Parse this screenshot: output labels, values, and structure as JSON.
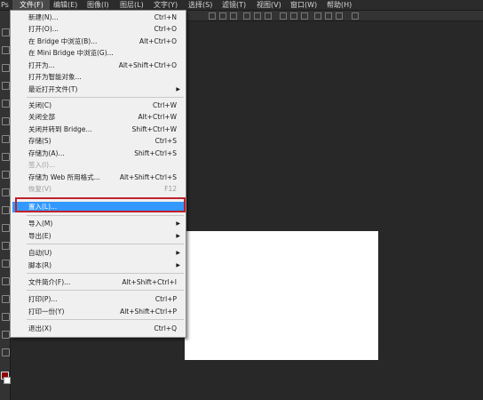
{
  "app": {
    "logo": "Ps"
  },
  "menubar": {
    "items": [
      {
        "label": "文件(F)"
      },
      {
        "label": "编辑(E)"
      },
      {
        "label": "图像(I)"
      },
      {
        "label": "图层(L)"
      },
      {
        "label": "文字(Y)"
      },
      {
        "label": "选择(S)"
      },
      {
        "label": "滤镜(T)"
      },
      {
        "label": "视图(V)"
      },
      {
        "label": "窗口(W)"
      },
      {
        "label": "帮助(H)"
      }
    ]
  },
  "file_menu": {
    "items": [
      {
        "label": "新建(N)...",
        "shortcut": "Ctrl+N"
      },
      {
        "label": "打开(O)...",
        "shortcut": "Ctrl+O"
      },
      {
        "label": "在 Bridge 中浏览(B)...",
        "shortcut": "Alt+Ctrl+O"
      },
      {
        "label": "在 Mini Bridge 中浏览(G)...",
        "shortcut": ""
      },
      {
        "label": "打开为...",
        "shortcut": "Alt+Shift+Ctrl+O"
      },
      {
        "label": "打开为智能对象...",
        "shortcut": ""
      },
      {
        "label": "最近打开文件(T)",
        "shortcut": "",
        "submenu": "▶"
      },
      {
        "label": "关闭(C)",
        "shortcut": "Ctrl+W"
      },
      {
        "label": "关闭全部",
        "shortcut": "Alt+Ctrl+W"
      },
      {
        "label": "关闭并转到 Bridge...",
        "shortcut": "Shift+Ctrl+W"
      },
      {
        "label": "存储(S)",
        "shortcut": "Ctrl+S"
      },
      {
        "label": "存储为(A)...",
        "shortcut": "Shift+Ctrl+S"
      },
      {
        "label": "签入(I)...",
        "shortcut": ""
      },
      {
        "label": "存储为 Web 所用格式...",
        "shortcut": "Alt+Shift+Ctrl+S"
      },
      {
        "label": "恢复(V)",
        "shortcut": "F12"
      },
      {
        "label": "置入(L)...",
        "shortcut": ""
      },
      {
        "label": "导入(M)",
        "shortcut": "",
        "submenu": "▶"
      },
      {
        "label": "导出(E)",
        "shortcut": "",
        "submenu": "▶"
      },
      {
        "label": "自动(U)",
        "shortcut": "",
        "submenu": "▶"
      },
      {
        "label": "脚本(R)",
        "shortcut": "",
        "submenu": "▶"
      },
      {
        "label": "文件简介(F)...",
        "shortcut": "Alt+Shift+Ctrl+I"
      },
      {
        "label": "打印(P)...",
        "shortcut": "Ctrl+P"
      },
      {
        "label": "打印一份(Y)",
        "shortcut": "Alt+Shift+Ctrl+P"
      },
      {
        "label": "退出(X)",
        "shortcut": "Ctrl+Q"
      }
    ]
  },
  "colors": {
    "workspace": "#282828",
    "menu_bg": "#f0f0f0",
    "highlight": "#3399ff",
    "annotation_box": "#c0202b",
    "foreground_swatch": "#8b0000",
    "background_swatch": "#ffffff"
  }
}
